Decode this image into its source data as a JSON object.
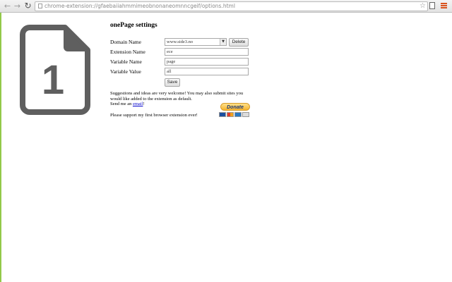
{
  "browser": {
    "url": "chrome-extension://gfaebaiiahmmimeobnonaneomnncgeif/options.html"
  },
  "logo": {
    "digit": "1"
  },
  "settings": {
    "title": "onePage settings",
    "domain_label": "Domain Name",
    "domain_value": "www.side3.no",
    "delete_label": "Delete",
    "extension_label": "Extension Name",
    "extension_value": "ece",
    "variable_name_label": "Variable Name",
    "variable_name_value": "page",
    "variable_value_label": "Variable Value",
    "variable_value_value": "all",
    "save_label": "Save"
  },
  "info": {
    "suggestions_text": "Suggestions and ideas are very welcome! You may also submit sites you would like added to the extension as default.",
    "send_prefix": "Send me an ",
    "email_link": "email",
    "send_suffix": "!",
    "support_text": "Please support my first browser extension ever!"
  },
  "donate": {
    "label": "Donate"
  },
  "colors": {
    "accent_rule": "#93c94a",
    "logo_gray": "#5f5f5f",
    "link": "#0000cc"
  }
}
